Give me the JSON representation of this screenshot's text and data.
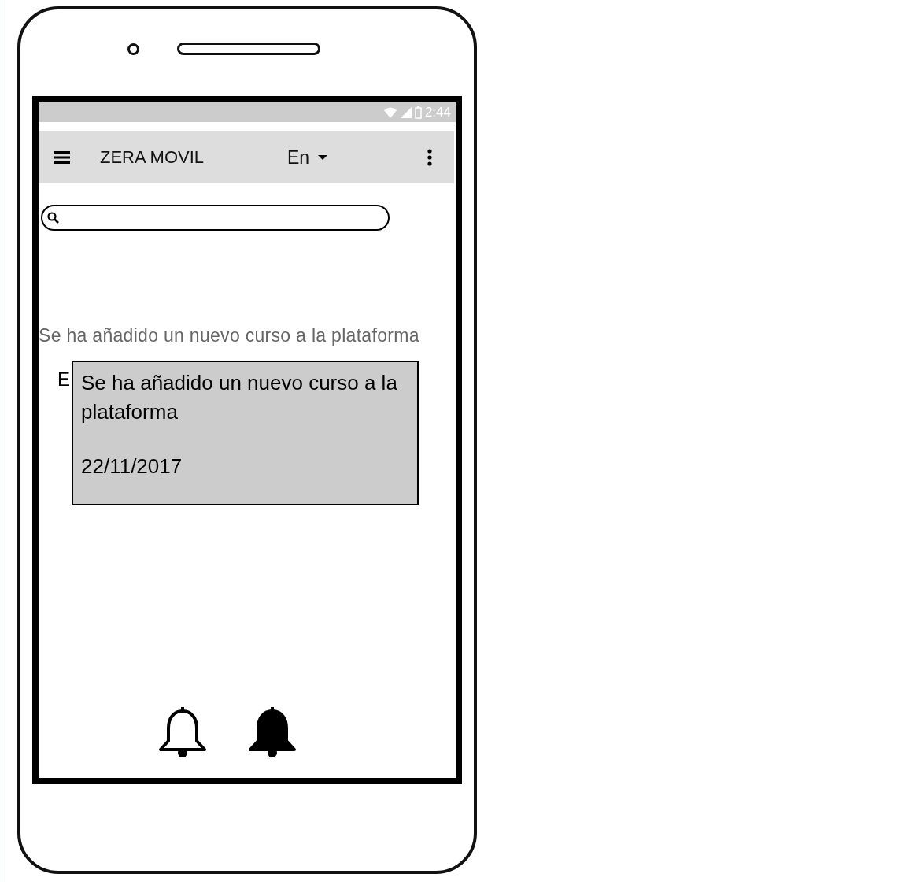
{
  "status_bar": {
    "time": "2:44"
  },
  "app_bar": {
    "title": "ZERA MOVIL",
    "language": "En"
  },
  "notification_text": "Se ha añadido un nuevo curso a la plataforma",
  "list_item_text": "E",
  "popup": {
    "text": "Se ha añadido un nuevo curso a la plataforma",
    "date": "22/11/2017"
  },
  "bells": [
    {
      "kind": "outline"
    },
    {
      "kind": "filled"
    }
  ]
}
